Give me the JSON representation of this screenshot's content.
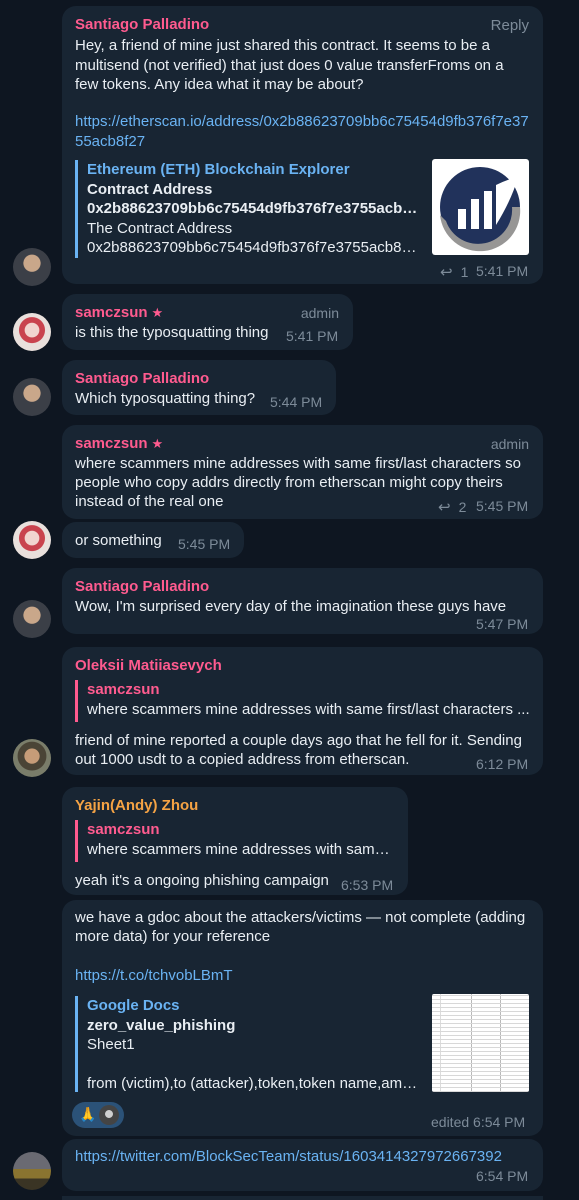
{
  "messages": {
    "m1": {
      "author": "Santiago Palladino",
      "reply_label": "Reply",
      "text": "Hey, a friend of mine just shared this contract. It seems to be a multisend (not verified) that just does 0 value transferFroms on a few tokens. Any idea what it may be about?",
      "link": "https://etherscan.io/address/0x2b88623709bb6c75454d9fb376f7e3755acb8f27",
      "preview": {
        "site": "Ethereum (ETH) Blockchain Explorer",
        "title": "Contract Address",
        "title2": "0x2b88623709bb6c75454d9fb376f7e3755acb8f...",
        "desc1": "The Contract Address",
        "desc2": "0x2b88623709bb6c75454d9fb376f7e3755acb8f2..."
      },
      "reply_count": "1",
      "time": "5:41 PM"
    },
    "m2": {
      "author": "samczsun",
      "star": "★",
      "role": "admin",
      "text": "is this the typosquatting thing",
      "time": "5:41 PM"
    },
    "m3": {
      "author": "Santiago Palladino",
      "text": "Which typosquatting thing?",
      "time": "5:44 PM"
    },
    "m4": {
      "author": "samczsun",
      "star": "★",
      "role": "admin",
      "line1": "where scammers mine addresses with same first/last characters so",
      "line2": "people who copy addrs directly from etherscan might copy theirs",
      "line3": "instead of the real one",
      "reply_count": "2",
      "time": "5:45 PM"
    },
    "m5": {
      "text": "or something",
      "time": "5:45 PM"
    },
    "m6": {
      "author": "Santiago Palladino",
      "text": "Wow, I'm surprised every day of the imagination these guys have",
      "time": "5:47 PM"
    },
    "m7": {
      "author": "Oleksii Matiiasevych",
      "quote_author": "samczsun",
      "quote_text": "where scammers mine addresses with same first/last characters ...",
      "line1": "friend of mine reported a couple days ago that he fell for it. Sending",
      "line2": "out 1000 usdt to a copied address from etherscan.",
      "time": "6:12 PM"
    },
    "m8": {
      "author": "Yajin(Andy) Zhou",
      "quote_author": "samczsun",
      "quote_text": "where scammers mine addresses with same...",
      "text": "yeah it's a ongoing phishing campaign",
      "time": "6:53 PM"
    },
    "m9": {
      "line1": "we have a gdoc about the attackers/victims — not complete (adding",
      "line2": "more data) for your reference",
      "link": "https://t.co/tchvobLBmT",
      "preview": {
        "site": "Google Docs",
        "title": "zero_value_phishing",
        "desc1": "Sheet1",
        "desc2": "from (victim),to (attacker),token,token name,amo..."
      },
      "reaction": "🙏",
      "time": "edited 6:54 PM"
    },
    "m10": {
      "link": "https://twitter.com/BlockSecTeam/status/1603414327972667392",
      "time": "6:54 PM"
    }
  },
  "colors": {
    "background": "#0e1621",
    "bubble": "#182533",
    "name_pink": "#ff5b8f",
    "name_orange": "#f5a344",
    "link": "#6ab3f3",
    "meta": "#7d8b99"
  }
}
